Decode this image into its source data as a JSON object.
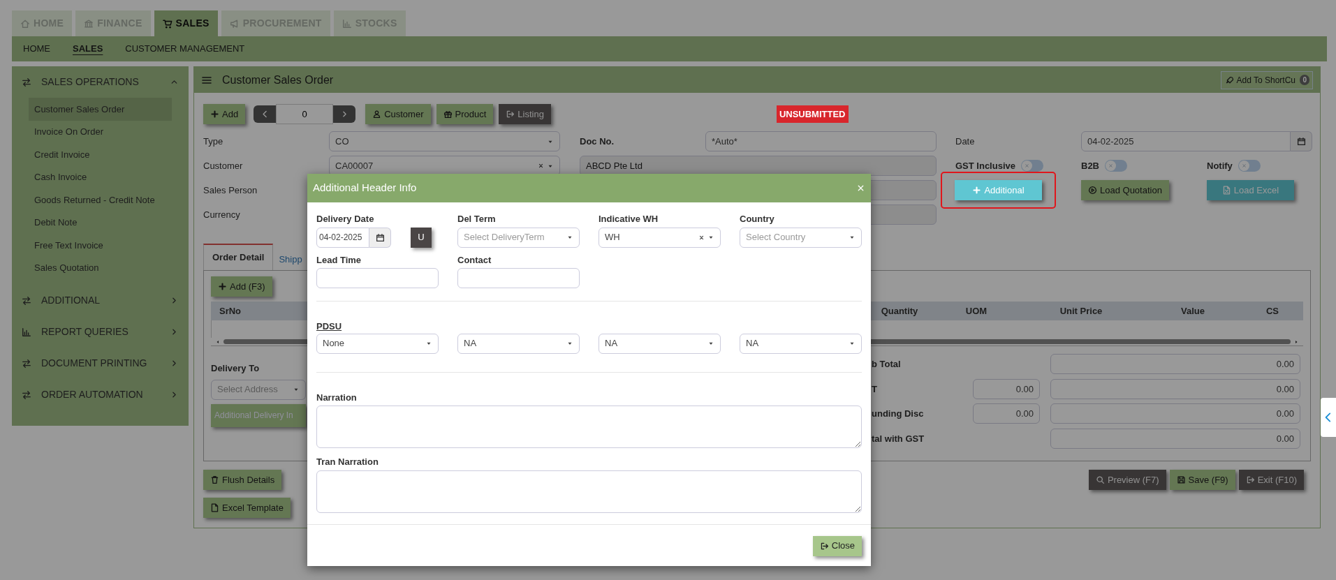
{
  "module_tabs": [
    {
      "label": "HOME",
      "selected": false
    },
    {
      "label": "FINANCE",
      "selected": false
    },
    {
      "label": "SALES",
      "selected": true
    },
    {
      "label": "PROCUREMENT",
      "selected": false
    },
    {
      "label": "STOCKS",
      "selected": false
    }
  ],
  "sub_nav": [
    {
      "label": "HOME",
      "selected": false
    },
    {
      "label": "SALES",
      "selected": true
    },
    {
      "label": "CUSTOMER MANAGEMENT",
      "selected": false
    }
  ],
  "sidebar": {
    "sections": [
      {
        "label": "SALES OPERATIONS",
        "expanded": true,
        "items": [
          {
            "label": "Customer Sales Order",
            "selected": true
          },
          {
            "label": "Invoice On Order",
            "selected": false
          },
          {
            "label": "Credit Invoice",
            "selected": false
          },
          {
            "label": "Cash Invoice",
            "selected": false
          },
          {
            "label": "Goods Returned - Credit Note",
            "selected": false
          },
          {
            "label": "Debit Note",
            "selected": false
          },
          {
            "label": "Free Text Invoice",
            "selected": false
          },
          {
            "label": "Sales Quotation",
            "selected": false
          }
        ]
      },
      {
        "label": "ADDITIONAL",
        "expanded": false
      },
      {
        "label": "REPORT QUERIES",
        "expanded": false
      },
      {
        "label": "DOCUMENT PRINTING",
        "expanded": false
      },
      {
        "label": "ORDER AUTOMATION",
        "expanded": false
      }
    ]
  },
  "panel": {
    "title": "Customer Sales Order",
    "shortcut_button": "Add To ShortCu",
    "shortcut_badge": "0"
  },
  "toolbar": {
    "add_button": "Add",
    "page_number": "0",
    "buttons": [
      {
        "label": "Customer",
        "kind": "green"
      },
      {
        "label": "Product",
        "kind": "green"
      },
      {
        "label": "Listing",
        "kind": "dark"
      }
    ]
  },
  "status_badge": "UNSUBMITTED",
  "form": {
    "type": {
      "label": "Type",
      "value": "CO"
    },
    "customer": {
      "label": "Customer",
      "value": "CA00007",
      "clearable": true
    },
    "sales_person": {
      "label": "Sales Person"
    },
    "currency": {
      "label": "Currency"
    },
    "doc_no": {
      "label": "Doc No.",
      "value": "*Auto*"
    },
    "customer_name": {
      "value": "ABCD Pte Ltd"
    },
    "date": {
      "label": "Date",
      "value": "04-02-2025"
    }
  },
  "switches": [
    {
      "label": "GST Inclusive",
      "on": false
    },
    {
      "label": "B2B",
      "on": false
    },
    {
      "label": "Notify",
      "on": false
    }
  ],
  "action_buttons": [
    {
      "label": "Additional",
      "kind": "teal",
      "highlighted": true
    },
    {
      "label": "Load Quotation",
      "kind": "green",
      "highlighted": false
    },
    {
      "label": "Load Excel",
      "kind": "teal",
      "highlighted": false
    }
  ],
  "detail_tabs": [
    {
      "label": "Order Detail",
      "selected": true
    },
    {
      "label": "Shipp",
      "selected": false
    }
  ],
  "detail": {
    "add_button": "Add (F3)",
    "columns": [
      "SrNo",
      "Quantity",
      "UOM",
      "Unit Price",
      "Value",
      "CS"
    ],
    "delivery_label": "Delivery To",
    "delivery_placeholder": "Select Address",
    "delivery_button": "Additional Delivery In",
    "totals": [
      {
        "label": "b Total",
        "value": "0.00"
      },
      {
        "label": "T",
        "rate": "0.00",
        "value": "0.00"
      },
      {
        "label": "unding Disc",
        "rate": "0.00",
        "value": "0.00"
      },
      {
        "label": "tal with GST",
        "value": "0.00"
      }
    ]
  },
  "footer_left": [
    "Flush Details",
    "Excel Template"
  ],
  "footer_right": [
    {
      "label": "Preview (F7)",
      "kind": "dark"
    },
    {
      "label": "Save (F9)",
      "kind": "green"
    },
    {
      "label": "Exit (F10)",
      "kind": "dark"
    }
  ],
  "modal": {
    "title": "Additional Header Info",
    "fields": [
      {
        "kind": "date",
        "label": "Delivery Date",
        "value": "04-02-2025",
        "side_button": "U"
      },
      {
        "kind": "select",
        "label": "Del Term",
        "placeholder": "Select DeliveryTerm"
      },
      {
        "kind": "select",
        "label": "Indicative WH",
        "value": "WH",
        "clearable": true
      },
      {
        "kind": "select",
        "label": "Country",
        "placeholder": "Select Country"
      },
      {
        "kind": "input",
        "label": "Lead Time"
      },
      {
        "kind": "input",
        "label": "Contact"
      }
    ],
    "pdsu": {
      "label": "PDSU",
      "values": [
        "None",
        "NA",
        "NA",
        "NA"
      ]
    },
    "narrations": [
      {
        "label": "Narration"
      },
      {
        "label": "Tran Narration"
      }
    ],
    "close_button": "Close"
  }
}
